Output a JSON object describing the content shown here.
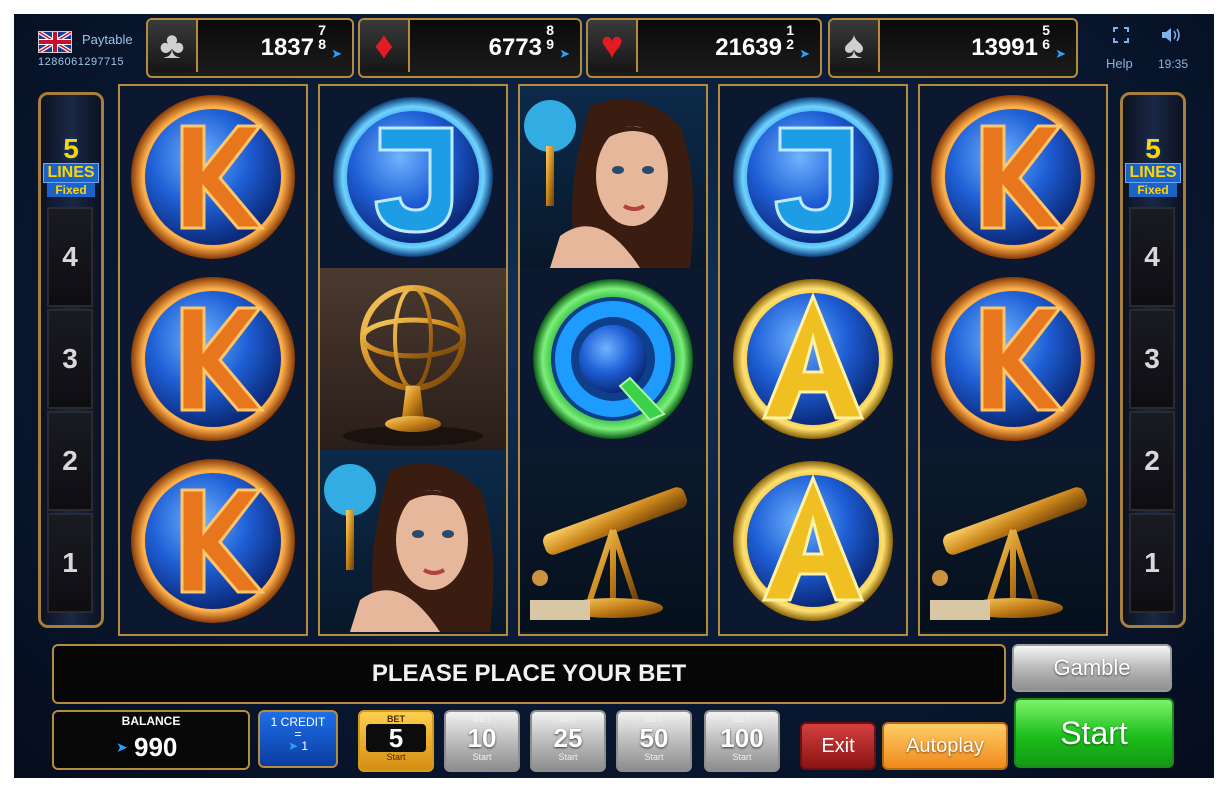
{
  "header": {
    "paytable_label": "Paytable",
    "ticket_id": "1286061297715",
    "help_label": "Help",
    "time": "19:35",
    "flag_icon": "uk-flag-icon",
    "fullscreen_icon": "fullscreen-icon",
    "sound_icon": "speaker-icon"
  },
  "jackpots": [
    {
      "suit": "clubs",
      "symbol": "♣",
      "value": "1837",
      "sub": "7\n8"
    },
    {
      "suit": "diamonds",
      "symbol": "♦",
      "value": "6773",
      "sub": "8\n9"
    },
    {
      "suit": "hearts",
      "symbol": "♥",
      "value": "21639",
      "sub": "1\n2"
    },
    {
      "suit": "spades",
      "symbol": "♠",
      "value": "13991",
      "sub": "5\n6"
    }
  ],
  "line_panel": {
    "count": "5",
    "lines_label": "LINES",
    "fixed_label": "Fixed",
    "numbers": [
      "4",
      "3",
      "2",
      "1"
    ]
  },
  "reels": [
    [
      "K",
      "K",
      "K"
    ],
    [
      "J",
      "armillary-sphere",
      "woman"
    ],
    [
      "woman",
      "Q",
      "telescope"
    ],
    [
      "J",
      "A",
      "A"
    ],
    [
      "K",
      "K",
      "telescope"
    ]
  ],
  "message": "PLEASE PLACE YOUR BET",
  "controls": {
    "gamble_label": "Gamble",
    "balance_label": "BALANCE",
    "balance_value": "990",
    "credit_label": "1 CREDIT",
    "credit_eq": "=",
    "credit_value": "1",
    "bet_label": "BET",
    "bet_start_label": "Start",
    "bets": [
      "5",
      "10",
      "25",
      "50",
      "100"
    ],
    "active_bet": "5",
    "exit_label": "Exit",
    "autoplay_label": "Autoplay",
    "start_label": "Start"
  },
  "colors": {
    "frame_gold": "#b58b3d",
    "accent_blue": "#2aa0ff",
    "start_green": "#1cbf1c",
    "exit_red": "#8b1414",
    "autoplay_orange": "#f08a1c"
  }
}
